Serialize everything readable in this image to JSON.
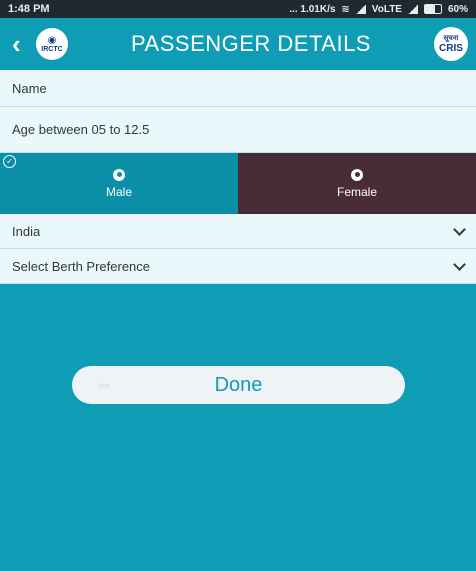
{
  "status_bar": {
    "time": "1:48 PM",
    "network_speed": "... 1.01K/s",
    "network_type": "VoLTE",
    "battery": "60%",
    "battery_level": 0.6
  },
  "header": {
    "back_icon": "chevron-left-icon",
    "logo_text": "IRCTC",
    "title": "PASSENGER DETAILS",
    "cris_top": "सूचना",
    "cris_text": "CRIS"
  },
  "form": {
    "name_placeholder": "Name",
    "age_placeholder": "Age between 05 to 12.5",
    "gender": {
      "male_label": "Male",
      "female_label": "Female",
      "selected": "Male"
    },
    "nationality_value": "India",
    "berth_placeholder": "Select Berth Preference"
  },
  "done_button": {
    "label": "Done"
  },
  "colors": {
    "primary": "#0f9db5",
    "female_bg": "#4a2b38",
    "field_bg": "#eaf8fb"
  }
}
